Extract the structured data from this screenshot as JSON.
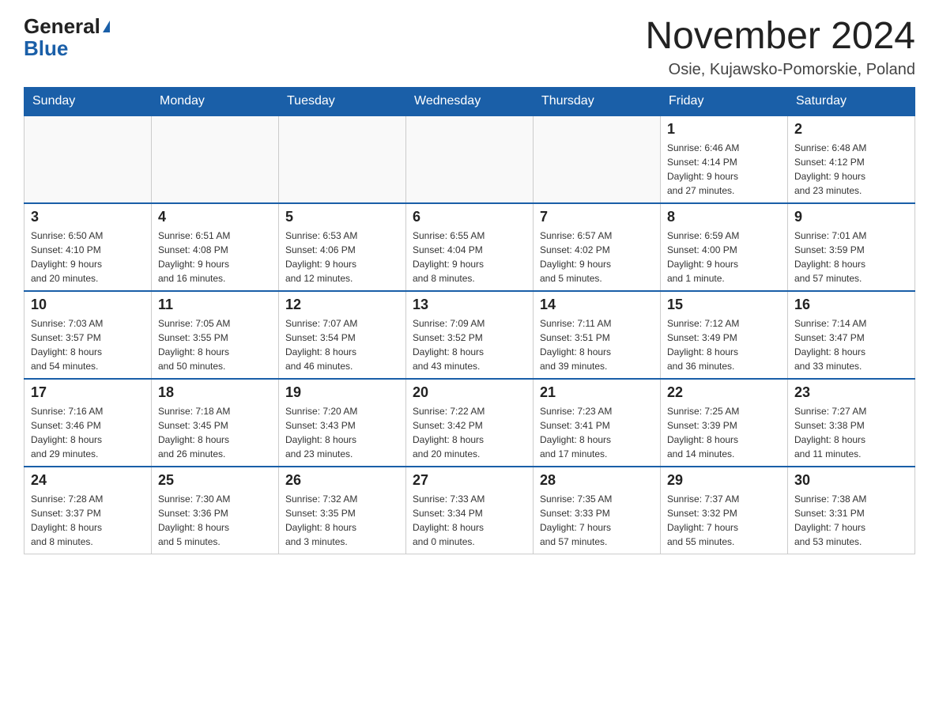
{
  "header": {
    "logo_general": "General",
    "logo_blue": "Blue",
    "month_title": "November 2024",
    "location": "Osie, Kujawsko-Pomorskie, Poland"
  },
  "weekdays": [
    "Sunday",
    "Monday",
    "Tuesday",
    "Wednesday",
    "Thursday",
    "Friday",
    "Saturday"
  ],
  "weeks": [
    [
      {
        "day": "",
        "info": ""
      },
      {
        "day": "",
        "info": ""
      },
      {
        "day": "",
        "info": ""
      },
      {
        "day": "",
        "info": ""
      },
      {
        "day": "",
        "info": ""
      },
      {
        "day": "1",
        "info": "Sunrise: 6:46 AM\nSunset: 4:14 PM\nDaylight: 9 hours\nand 27 minutes."
      },
      {
        "day": "2",
        "info": "Sunrise: 6:48 AM\nSunset: 4:12 PM\nDaylight: 9 hours\nand 23 minutes."
      }
    ],
    [
      {
        "day": "3",
        "info": "Sunrise: 6:50 AM\nSunset: 4:10 PM\nDaylight: 9 hours\nand 20 minutes."
      },
      {
        "day": "4",
        "info": "Sunrise: 6:51 AM\nSunset: 4:08 PM\nDaylight: 9 hours\nand 16 minutes."
      },
      {
        "day": "5",
        "info": "Sunrise: 6:53 AM\nSunset: 4:06 PM\nDaylight: 9 hours\nand 12 minutes."
      },
      {
        "day": "6",
        "info": "Sunrise: 6:55 AM\nSunset: 4:04 PM\nDaylight: 9 hours\nand 8 minutes."
      },
      {
        "day": "7",
        "info": "Sunrise: 6:57 AM\nSunset: 4:02 PM\nDaylight: 9 hours\nand 5 minutes."
      },
      {
        "day": "8",
        "info": "Sunrise: 6:59 AM\nSunset: 4:00 PM\nDaylight: 9 hours\nand 1 minute."
      },
      {
        "day": "9",
        "info": "Sunrise: 7:01 AM\nSunset: 3:59 PM\nDaylight: 8 hours\nand 57 minutes."
      }
    ],
    [
      {
        "day": "10",
        "info": "Sunrise: 7:03 AM\nSunset: 3:57 PM\nDaylight: 8 hours\nand 54 minutes."
      },
      {
        "day": "11",
        "info": "Sunrise: 7:05 AM\nSunset: 3:55 PM\nDaylight: 8 hours\nand 50 minutes."
      },
      {
        "day": "12",
        "info": "Sunrise: 7:07 AM\nSunset: 3:54 PM\nDaylight: 8 hours\nand 46 minutes."
      },
      {
        "day": "13",
        "info": "Sunrise: 7:09 AM\nSunset: 3:52 PM\nDaylight: 8 hours\nand 43 minutes."
      },
      {
        "day": "14",
        "info": "Sunrise: 7:11 AM\nSunset: 3:51 PM\nDaylight: 8 hours\nand 39 minutes."
      },
      {
        "day": "15",
        "info": "Sunrise: 7:12 AM\nSunset: 3:49 PM\nDaylight: 8 hours\nand 36 minutes."
      },
      {
        "day": "16",
        "info": "Sunrise: 7:14 AM\nSunset: 3:47 PM\nDaylight: 8 hours\nand 33 minutes."
      }
    ],
    [
      {
        "day": "17",
        "info": "Sunrise: 7:16 AM\nSunset: 3:46 PM\nDaylight: 8 hours\nand 29 minutes."
      },
      {
        "day": "18",
        "info": "Sunrise: 7:18 AM\nSunset: 3:45 PM\nDaylight: 8 hours\nand 26 minutes."
      },
      {
        "day": "19",
        "info": "Sunrise: 7:20 AM\nSunset: 3:43 PM\nDaylight: 8 hours\nand 23 minutes."
      },
      {
        "day": "20",
        "info": "Sunrise: 7:22 AM\nSunset: 3:42 PM\nDaylight: 8 hours\nand 20 minutes."
      },
      {
        "day": "21",
        "info": "Sunrise: 7:23 AM\nSunset: 3:41 PM\nDaylight: 8 hours\nand 17 minutes."
      },
      {
        "day": "22",
        "info": "Sunrise: 7:25 AM\nSunset: 3:39 PM\nDaylight: 8 hours\nand 14 minutes."
      },
      {
        "day": "23",
        "info": "Sunrise: 7:27 AM\nSunset: 3:38 PM\nDaylight: 8 hours\nand 11 minutes."
      }
    ],
    [
      {
        "day": "24",
        "info": "Sunrise: 7:28 AM\nSunset: 3:37 PM\nDaylight: 8 hours\nand 8 minutes."
      },
      {
        "day": "25",
        "info": "Sunrise: 7:30 AM\nSunset: 3:36 PM\nDaylight: 8 hours\nand 5 minutes."
      },
      {
        "day": "26",
        "info": "Sunrise: 7:32 AM\nSunset: 3:35 PM\nDaylight: 8 hours\nand 3 minutes."
      },
      {
        "day": "27",
        "info": "Sunrise: 7:33 AM\nSunset: 3:34 PM\nDaylight: 8 hours\nand 0 minutes."
      },
      {
        "day": "28",
        "info": "Sunrise: 7:35 AM\nSunset: 3:33 PM\nDaylight: 7 hours\nand 57 minutes."
      },
      {
        "day": "29",
        "info": "Sunrise: 7:37 AM\nSunset: 3:32 PM\nDaylight: 7 hours\nand 55 minutes."
      },
      {
        "day": "30",
        "info": "Sunrise: 7:38 AM\nSunset: 3:31 PM\nDaylight: 7 hours\nand 53 minutes."
      }
    ]
  ]
}
